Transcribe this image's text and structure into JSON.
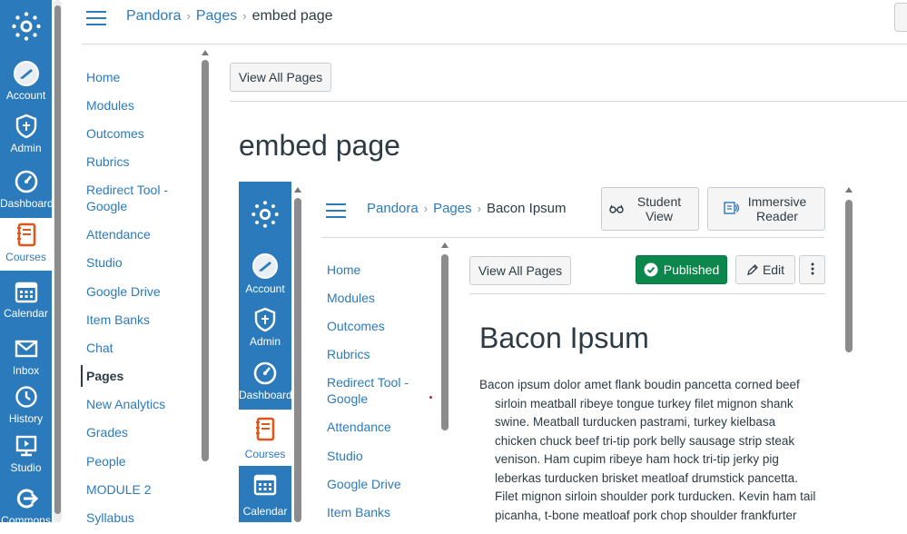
{
  "global_nav": {
    "items": [
      {
        "label": "Account",
        "icon": "account-icon"
      },
      {
        "label": "Admin",
        "icon": "admin-shield-icon"
      },
      {
        "label": "Dashboard",
        "icon": "dashboard-gauge-icon"
      },
      {
        "label": "Courses",
        "icon": "courses-book-icon"
      },
      {
        "label": "Calendar",
        "icon": "calendar-icon"
      },
      {
        "label": "Inbox",
        "icon": "inbox-icon"
      },
      {
        "label": "History",
        "icon": "history-clock-icon"
      },
      {
        "label": "Studio",
        "icon": "studio-icon"
      },
      {
        "label": "Commons",
        "icon": "commons-icon"
      }
    ]
  },
  "breadcrumb": {
    "course": "Pandora",
    "section": "Pages",
    "current": "embed page"
  },
  "course_nav": {
    "items": [
      "Home",
      "Modules",
      "Outcomes",
      "Rubrics",
      "Redirect Tool - Google",
      "Attendance",
      "Studio",
      "Google Drive",
      "Item Banks",
      "Chat",
      "Pages",
      "New Analytics",
      "Grades",
      "People",
      "MODULE 2",
      "Syllabus"
    ],
    "active": "Pages"
  },
  "toolbar": {
    "view_all_pages": "View All Pages"
  },
  "page": {
    "title": "embed page"
  },
  "embed": {
    "global_nav": {
      "items": [
        "Account",
        "Admin",
        "Dashboard",
        "Courses",
        "Calendar"
      ]
    },
    "breadcrumb": {
      "course": "Pandora",
      "section": "Pages",
      "current": "Bacon Ipsum"
    },
    "student_view": "Student View",
    "immersive_reader": "Immersive Reader",
    "course_nav": {
      "items": [
        "Home",
        "Modules",
        "Outcomes",
        "Rubrics",
        "Redirect Tool - Google",
        "Attendance",
        "Studio",
        "Google Drive",
        "Item Banks"
      ]
    },
    "view_all_pages": "View All Pages",
    "published": "Published",
    "edit": "Edit",
    "title": "Bacon Ipsum",
    "body_lines": [
      "Bacon ipsum dolor amet flank boudin pancetta corned beef",
      "sirloin meatball ribeye tongue turkey filet mignon shank",
      "swine. Meatball turducken pastrami, turkey kielbasa",
      "chicken chuck beef tri-tip pork belly sausage strip steak",
      "venison. Ham cupim ribeye ham hock tri-tip jerky pig",
      "leberkas turducken brisket meatloaf drumstick pancetta.",
      "Filet mignon sirloin shoulder pork turducken. Kevin ham tail",
      "picanha, t-bone meatloaf pork chop shoulder frankfurter"
    ]
  },
  "colors": {
    "brand": "#2b7abc",
    "published": "#0b874b",
    "text": "#2d3b45"
  }
}
